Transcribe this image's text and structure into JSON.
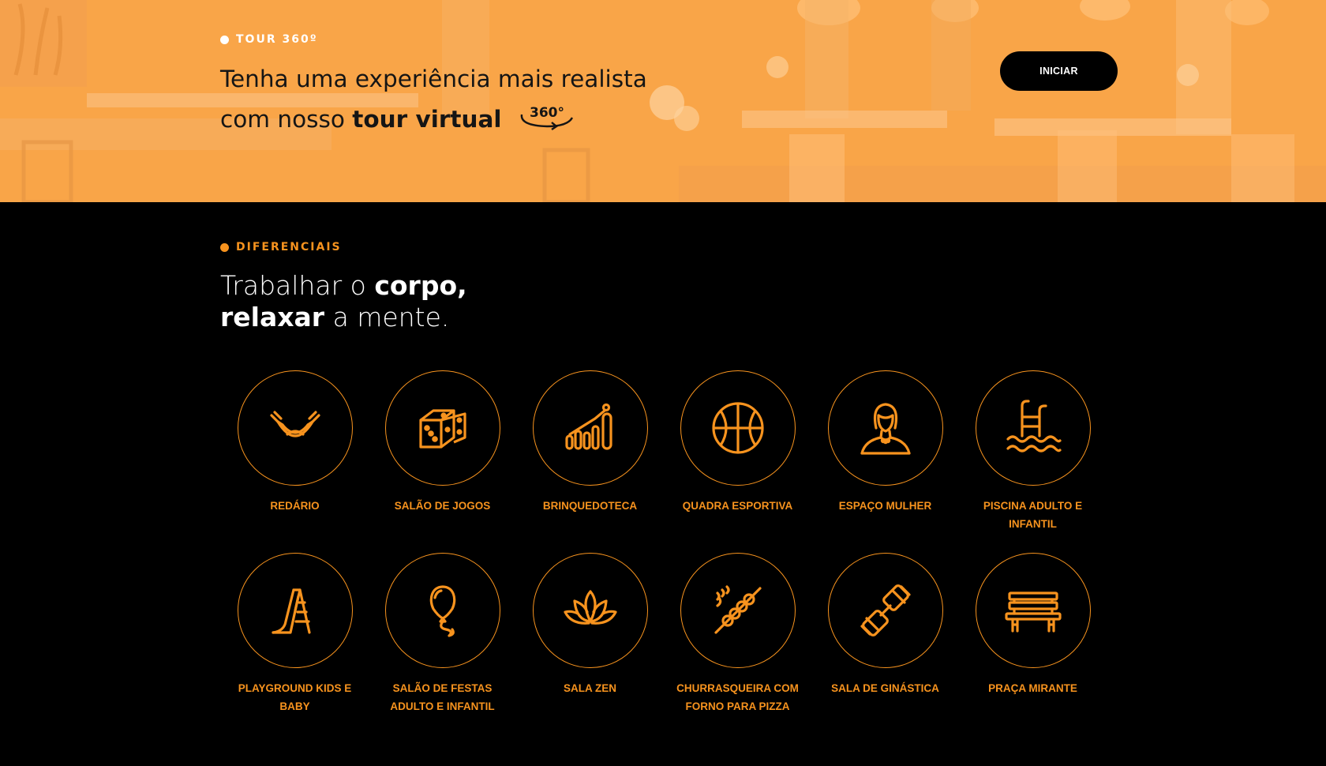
{
  "tour": {
    "kicker": "TOUR 360º",
    "title_line1": "Tenha uma experiência mais realista",
    "title_line2_prefix": "com nosso ",
    "title_line2_bold": "tour virtual",
    "icon_360_text": "360°",
    "start_label": "INICIAR",
    "colors": {
      "banner": "#f9a548",
      "button": "#000000"
    }
  },
  "features": {
    "kicker": "DIFERENCIAIS",
    "title": {
      "part1": "Trabalhar o ",
      "part1_bold": "corpo,",
      "part2_bold": "relaxar",
      "part2": " a mente."
    },
    "accent": "#f7931e",
    "items": [
      {
        "label": "REDÁRIO",
        "icon": "hammock-icon"
      },
      {
        "label": "SALÃO DE JOGOS",
        "icon": "dice-icon"
      },
      {
        "label": "BRINQUEDOTECA",
        "icon": "abacus-icon"
      },
      {
        "label": "QUADRA ESPORTIVA",
        "icon": "basketball-icon"
      },
      {
        "label": "ESPAÇO MULHER",
        "icon": "woman-icon"
      },
      {
        "label": "PISCINA ADULTO E INFANTIL",
        "icon": "pool-icon"
      },
      {
        "label": "PLAYGROUND KIDS E BABY",
        "icon": "slide-icon"
      },
      {
        "label": "SALÃO DE FESTAS ADULTO E INFANTIL",
        "icon": "balloon-icon"
      },
      {
        "label": "SALA ZEN",
        "icon": "lotus-icon"
      },
      {
        "label": "CHURRASQUEIRA COM FORNO PARA PIZZA",
        "icon": "skewer-icon"
      },
      {
        "label": "SALA DE GINÁSTICA",
        "icon": "dumbbell-icon"
      },
      {
        "label": "PRAÇA MIRANTE",
        "icon": "bench-icon"
      }
    ]
  }
}
